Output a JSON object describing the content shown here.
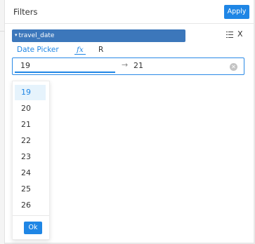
{
  "panel": {
    "title": "Filters",
    "apply_label": "Apply"
  },
  "filter": {
    "caret": "▾",
    "field_name": "travel_date",
    "list_icon": "list-icon",
    "close_label": "X"
  },
  "tabs": {
    "date_picker": "Date Picker",
    "fx": "fx",
    "r": "R"
  },
  "range": {
    "start": "19",
    "separator": "→",
    "end": "21",
    "clear_icon": "clear-circle-icon"
  },
  "dropdown": {
    "options": [
      "19",
      "20",
      "21",
      "22",
      "23",
      "24",
      "25",
      "26"
    ],
    "selected": "19",
    "ok_label": "Ok"
  },
  "colors": {
    "accent": "#1f86e5",
    "field_bar": "#3c77bb",
    "selected_bg": "#e6f3fc"
  }
}
